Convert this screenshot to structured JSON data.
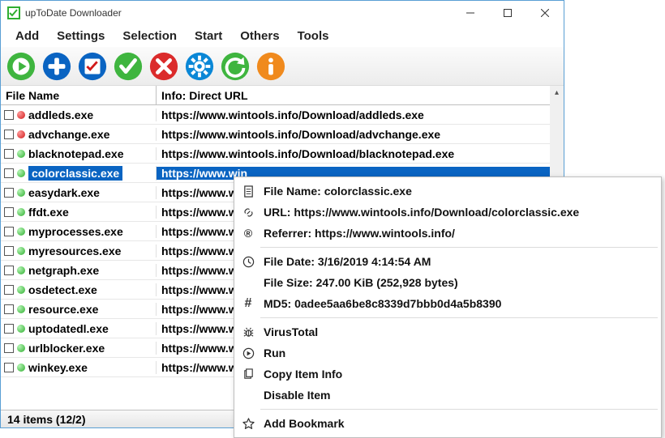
{
  "window": {
    "title": "upToDate Downloader"
  },
  "menubar": [
    "Add",
    "Settings",
    "Selection",
    "Start",
    "Others",
    "Tools"
  ],
  "toolbar_icons": [
    "play",
    "plus",
    "checklist",
    "check",
    "cancel",
    "gear",
    "reload",
    "info"
  ],
  "columns": {
    "file": "File Name",
    "info": "Info: Direct URL"
  },
  "rows": [
    {
      "status": "red",
      "name": "addleds.exe",
      "url": "https://www.wintools.info/Download/addleds.exe",
      "selected": false
    },
    {
      "status": "red",
      "name": "advchange.exe",
      "url": "https://www.wintools.info/Download/advchange.exe",
      "selected": false
    },
    {
      "status": "green",
      "name": "blacknotepad.exe",
      "url": "https://www.wintools.info/Download/blacknotepad.exe",
      "selected": false
    },
    {
      "status": "green",
      "name": "colorclassic.exe",
      "url": "https://www.win",
      "selected": true
    },
    {
      "status": "green",
      "name": "easydark.exe",
      "url": "https://www.win",
      "selected": false
    },
    {
      "status": "green",
      "name": "ffdt.exe",
      "url": "https://www.win",
      "selected": false
    },
    {
      "status": "green",
      "name": "myprocesses.exe",
      "url": "https://www.win",
      "selected": false
    },
    {
      "status": "green",
      "name": "myresources.exe",
      "url": "https://www.win",
      "selected": false
    },
    {
      "status": "green",
      "name": "netgraph.exe",
      "url": "https://www.win",
      "selected": false
    },
    {
      "status": "green",
      "name": "osdetect.exe",
      "url": "https://www.win",
      "selected": false
    },
    {
      "status": "green",
      "name": "resource.exe",
      "url": "https://www.win",
      "selected": false
    },
    {
      "status": "green",
      "name": "uptodatedl.exe",
      "url": "https://www.win",
      "selected": false
    },
    {
      "status": "green",
      "name": "urlblocker.exe",
      "url": "https://www.win",
      "selected": false
    },
    {
      "status": "green",
      "name": "winkey.exe",
      "url": "https://www.win",
      "selected": false
    }
  ],
  "status": "14 items (12/2)",
  "context": {
    "file_name_label": "File Name: colorclassic.exe",
    "url_label": "URL: https://www.wintools.info/Download/colorclassic.exe",
    "referrer_label": "Referrer: https://www.wintools.info/",
    "file_date_label": "File Date: 3/16/2019 4:14:54 AM",
    "file_size_label": "File Size: 247.00 KiB (252,928 bytes)",
    "md5_label": "MD5: 0adee5aa6be8c8339d7bbb0d4a5b8390",
    "virustotal": "VirusTotal",
    "run": "Run",
    "copy_info": "Copy Item Info",
    "disable": "Disable Item",
    "add_bookmark": "Add Bookmark"
  }
}
